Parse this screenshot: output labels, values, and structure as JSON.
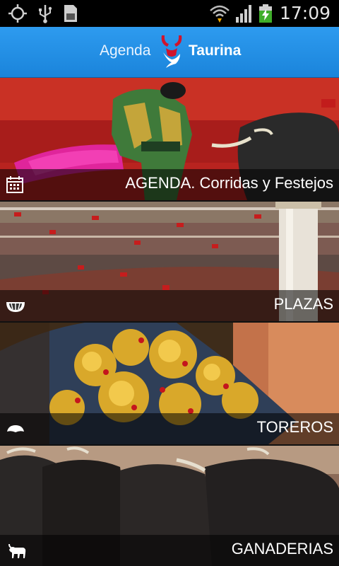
{
  "status_bar": {
    "icons": [
      "gps-icon",
      "usb-icon",
      "sd-card-icon",
      "wifi-icon",
      "signal-icon",
      "battery-charging-icon"
    ],
    "time": "17:09"
  },
  "header": {
    "logo_word1": "Agenda",
    "logo_word2": "Taurina",
    "logo_icon": "bull-horns-icon",
    "background": "#1a84db"
  },
  "menu": [
    {
      "label": "AGENDA. Corridas y Festejos",
      "icon": "calendar-icon"
    },
    {
      "label": "PLAZAS",
      "icon": "bullring-icon"
    },
    {
      "label": "TOREROS",
      "icon": "montera-hat-icon"
    },
    {
      "label": "GANADERIAS",
      "icon": "bull-icon"
    }
  ]
}
